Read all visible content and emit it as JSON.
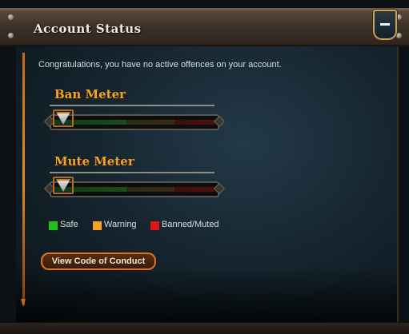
{
  "panel": {
    "title": "Account Status",
    "collapse_icon": "minus-icon"
  },
  "message": "Congratulations, you have no active offences on your account.",
  "meters": [
    {
      "label": "Ban Meter",
      "value": 0
    },
    {
      "label": "Mute Meter",
      "value": 0
    }
  ],
  "legend": [
    {
      "label": "Safe",
      "color": "#1fbf1f"
    },
    {
      "label": "Warning",
      "color": "#f0a326"
    },
    {
      "label": "Banned/Muted",
      "color": "#d81818"
    }
  ],
  "button": {
    "label": "View Code of Conduct"
  },
  "colors": {
    "accent": "#f0a326",
    "button_border": "#d07a2a"
  }
}
